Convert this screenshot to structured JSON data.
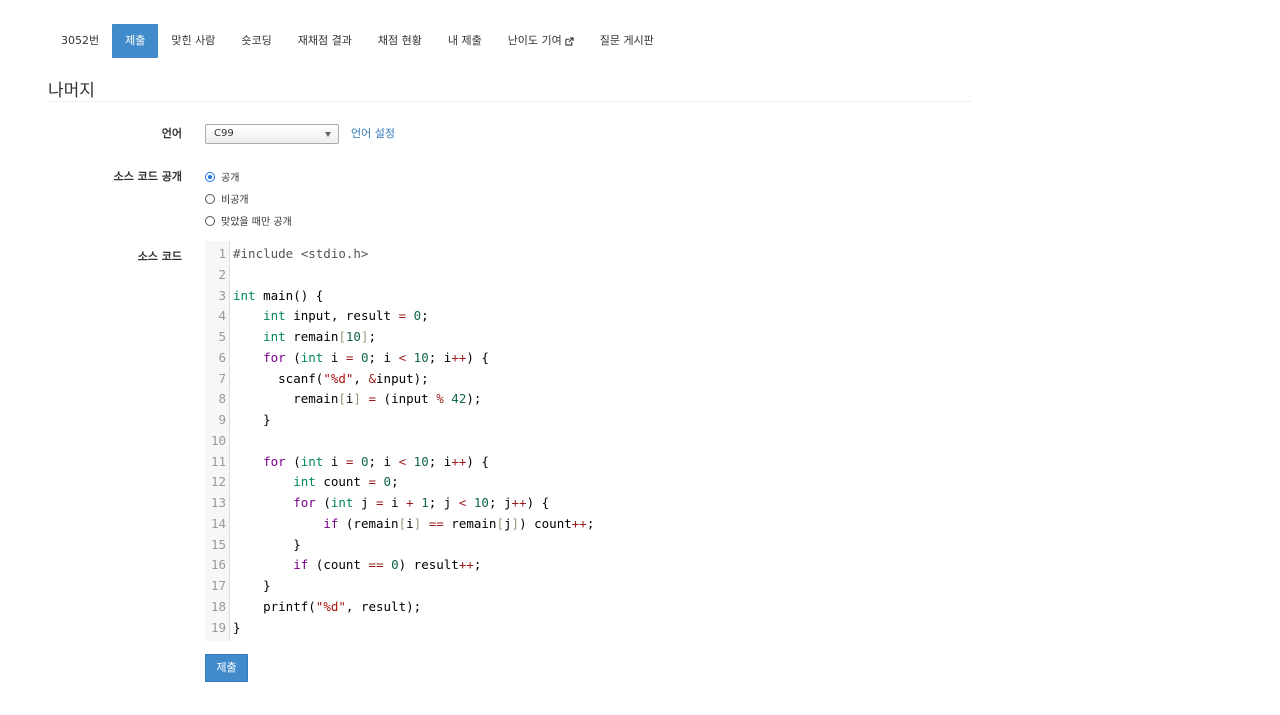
{
  "nav": {
    "tabs": [
      {
        "label": "3052번",
        "active": false
      },
      {
        "label": "제출",
        "active": true
      },
      {
        "label": "맞힌 사람",
        "active": false
      },
      {
        "label": "숏코딩",
        "active": false
      },
      {
        "label": "재채점 결과",
        "active": false
      },
      {
        "label": "채점 현황",
        "active": false
      },
      {
        "label": "내 제출",
        "active": false
      },
      {
        "label": "난이도 기여",
        "active": false,
        "icon": "external-link-icon"
      },
      {
        "label": "질문 게시판",
        "active": false
      }
    ]
  },
  "page_title": "나머지",
  "form": {
    "language_label": "언어",
    "language_value": "C99",
    "language_settings_link": "언어 설정",
    "visibility_label": "소스 코드 공개",
    "visibility_options": [
      {
        "label": "공개",
        "checked": true
      },
      {
        "label": "비공개",
        "checked": false
      },
      {
        "label": "맞았을 때만 공개",
        "checked": false
      }
    ],
    "source_label": "소스 코드",
    "submit_label": "제출"
  },
  "code_lines": [
    "#include <stdio.h>",
    "",
    "int main() {",
    "    int input, result = 0;",
    "    int remain[10];",
    "    for (int i = 0; i < 10; i++) {",
    "      scanf(\"%d\", &input);",
    "        remain[i] = (input % 42);",
    "    }",
    "",
    "    for (int i = 0; i < 10; i++) {",
    "        int count = 0;",
    "        for (int j = i + 1; j < 10; j++) {",
    "            if (remain[i] == remain[j]) count++;",
    "        }",
    "        if (count == 0) result++;",
    "    }",
    "    printf(\"%d\", result);",
    "}"
  ],
  "colors": {
    "accent": "#428bca",
    "keyword": "#770088",
    "type": "#008855",
    "number": "#116644",
    "string": "#aa1111",
    "operator": "#981a1a",
    "preprocessor": "#555555",
    "bracket": "#999977"
  }
}
